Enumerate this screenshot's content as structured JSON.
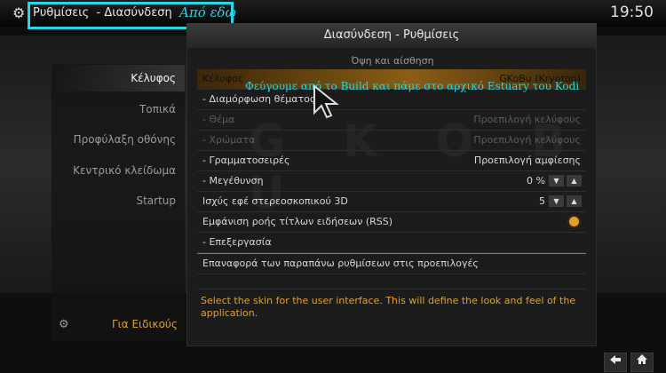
{
  "topbar": {
    "breadcrumb": "Ρυθμίσεις  - Διασύνδεση",
    "annotation_title": "Από εδώ",
    "clock": "19:50",
    "gear_icon": "gear-icon"
  },
  "sidebar": {
    "items": [
      {
        "label": "Κέλυφος",
        "active": true
      },
      {
        "label": "Τοπικά",
        "active": false
      },
      {
        "label": "Προφύλαξη οθόνης",
        "active": false
      },
      {
        "label": "Κεντρικό κλείδωμα",
        "active": false
      },
      {
        "label": "Startup",
        "active": false
      }
    ],
    "bottom_label": "Για Ειδικούς"
  },
  "panel": {
    "title": "Διασύνδεση - Ρυθμίσεις",
    "section": "Όψη και αίσθηση",
    "watermark": "G K O B U",
    "rows": [
      {
        "label": "Κέλυφος",
        "value": "GKoBu (Krypton)"
      },
      {
        "label": "- Διαμόρφωση θέματος",
        "value": ""
      },
      {
        "label": "- Θέμα",
        "value": "Προεπιλογή κελύφους"
      },
      {
        "label": "- Χρώματα",
        "value": "Προεπιλογή κελύφους"
      },
      {
        "label": "- Γραμματοσειρές",
        "value": "Προεπιλογή αμφίεσης"
      },
      {
        "label": "- Μεγέθυνση",
        "value": "0 %"
      },
      {
        "label": "Ισχύς εφέ στερεοσκοπικού 3D",
        "value": "5"
      },
      {
        "label": "Εμφάνιση ροής τίτλων ειδήσεων (RSS)",
        "value": ""
      },
      {
        "label": "- Επεξεργασία",
        "value": ""
      },
      {
        "label": "Επαναφορά των παραπάνω ρυθμίσεων στις προεπιλογές",
        "value": ""
      }
    ],
    "annotation_text": "Φεύγουμε από το Build και πάμε στο αρχικό Estuary του Kodi",
    "description": "Select the skin for the user interface. This will define the look and feel of the application."
  },
  "bottom_buttons": {
    "back_icon": "back-arrow-icon",
    "home_icon": "home-icon"
  }
}
